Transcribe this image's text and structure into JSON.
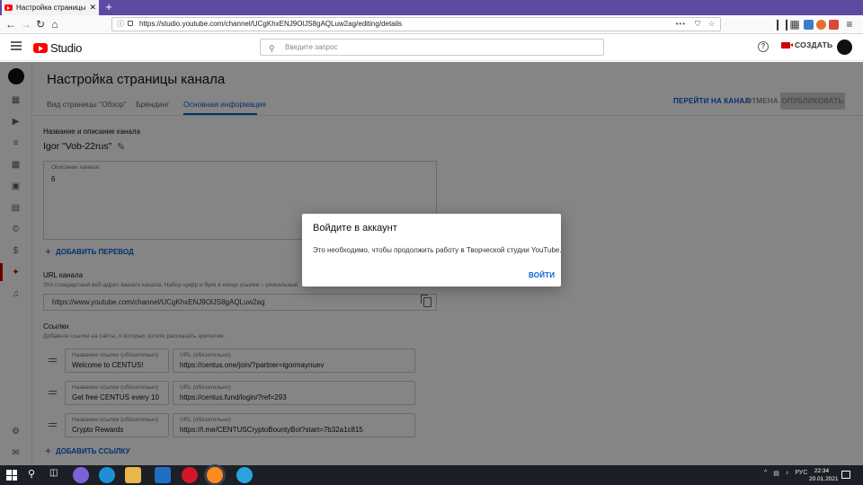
{
  "browser": {
    "tab_title": "Настройка страницы канала",
    "url": "https://studio.youtube.com/channel/UCgKhxENJ9OlJS8gAQLuw2ag/editing/details"
  },
  "app": {
    "logo_text": "Studio",
    "search_placeholder": "Введите запрос",
    "create_label": "СОЗДАТЬ"
  },
  "page": {
    "title": "Настройка страницы канала",
    "tabs": [
      {
        "label": "Вид страницы \"Обзор\""
      },
      {
        "label": "Брендинг"
      },
      {
        "label": "Основная информация"
      }
    ],
    "go_to_channel": "ПЕРЕЙТИ НА КАНАЛ",
    "cancel": "ОТМЕНА",
    "publish": "ОПУБЛИКОВАТЬ"
  },
  "basic": {
    "name_section_title": "Название и описание канала",
    "channel_name": "Igor \"Vob-22rus\"",
    "description_label": "Описание канала",
    "description_value": "6",
    "add_translation": "ДОБАВИТЬ ПЕРЕВОД",
    "url_section_title": "URL канала",
    "url_hint": "Это стандартный веб-адрес вашего канала. Набор цифр и букв в конце ссылки – уникальный",
    "channel_url": "https://www.youtube.com/channel/UCgKhxENJ9OlJS8gAQLuw2ag",
    "links_section_title": "Ссылки",
    "links_hint": "Добавьте ссылки на сайты, о которых хотите рассказать зрителям.",
    "link_title_label": "Название ссылки (обязательно)",
    "link_url_label": "URL (обязательно)",
    "links": [
      {
        "title": "Welcome to CENTUS!",
        "url": "https://centus.one/join/?partner=igormaynuev"
      },
      {
        "title": "Get free CENTUS every 10",
        "url": "https://centus.fund/login/?ref=293"
      },
      {
        "title": "Crypto Rewards",
        "url": "https://t.me/CENTUSCryptoBountyBot?start=7b32a1c815"
      }
    ],
    "add_link": "ДОБАВИТЬ ССЫЛКУ"
  },
  "dialog": {
    "title": "Войдите в аккаунт",
    "text": "Это необходимо, чтобы продолжить работу в Творческой студии YouTube.",
    "button": "ВОЙТИ"
  },
  "taskbar": {
    "lang": "РУС",
    "time": "22:34",
    "date": "20.01.2021"
  },
  "colors": {
    "accent": "#065fd4",
    "youtube_red": "#ff0000",
    "browser_tabbar": "#5d4ba3"
  }
}
